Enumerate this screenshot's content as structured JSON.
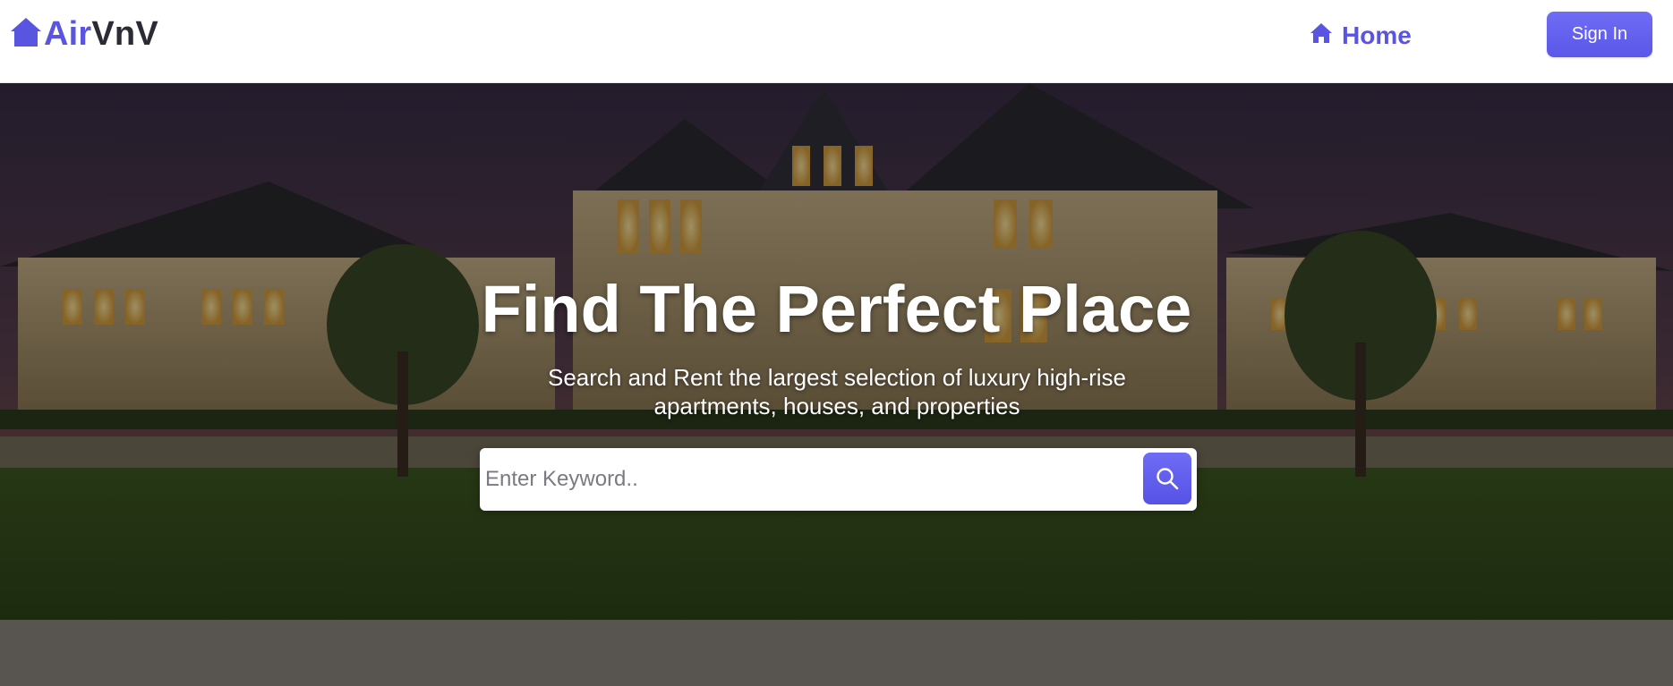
{
  "header": {
    "logo": {
      "part1": "Air",
      "part2": "VnV",
      "icon": "house-icon"
    },
    "nav": {
      "home_label": "Home",
      "home_icon": "home-icon"
    },
    "signin_label": "Sign In"
  },
  "hero": {
    "title": "Find The Perfect Place",
    "subtitle": "Search and Rent the largest selection of luxury high-rise apartments, houses, and properties",
    "search": {
      "placeholder": "Enter Keyword..",
      "value": "",
      "button_icon": "search-icon"
    }
  },
  "colors": {
    "accent": "#5a55e0",
    "button": "#6360ef",
    "logo_dark": "#2b2b35"
  }
}
